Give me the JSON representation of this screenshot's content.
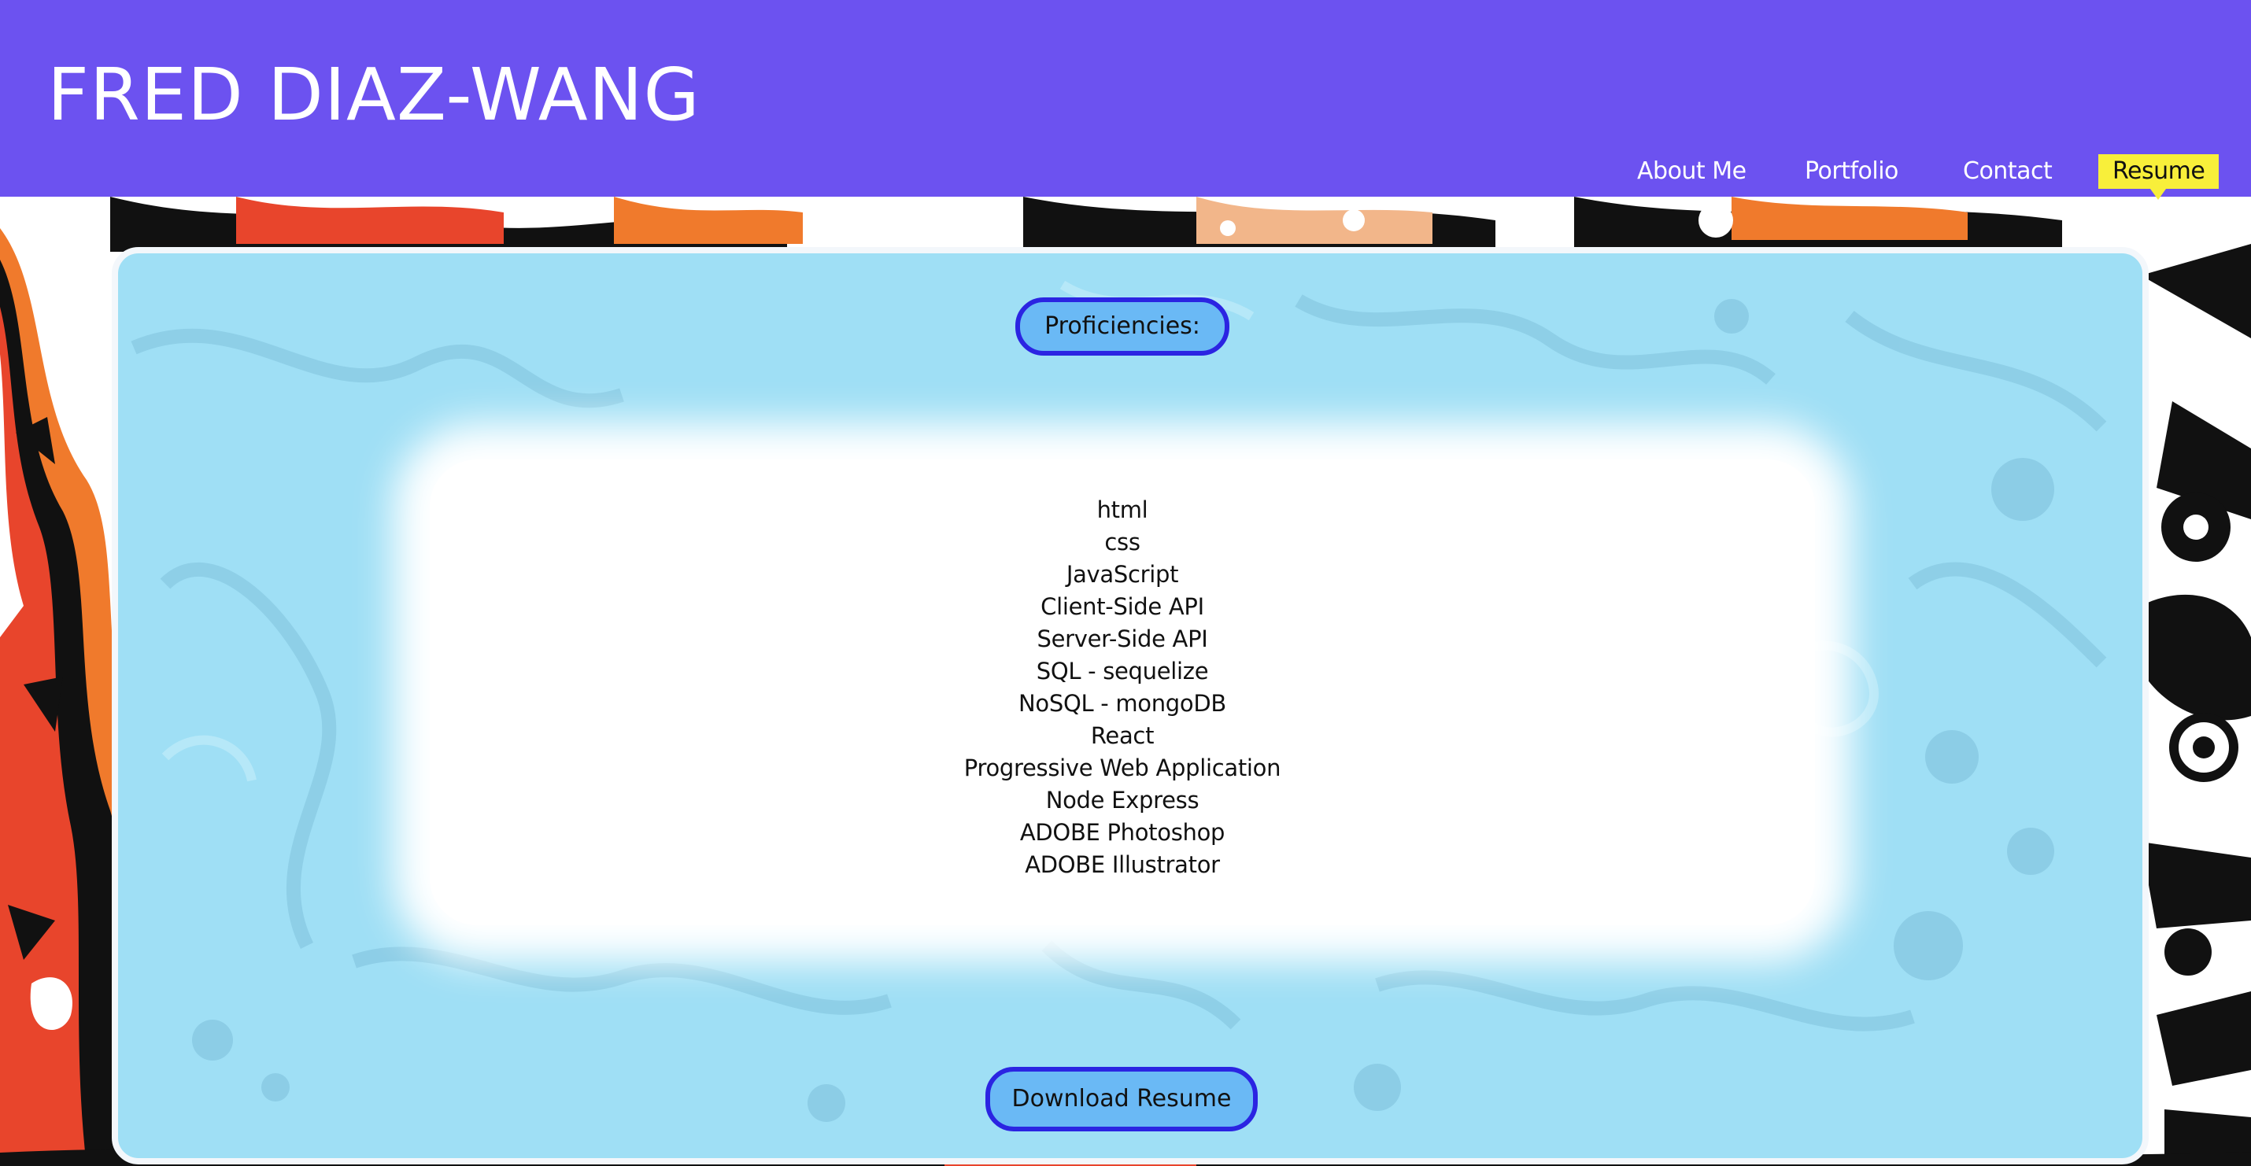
{
  "header": {
    "title": "FRED DIAZ-WANG",
    "background_color": "#6c52f0"
  },
  "nav": {
    "items": [
      {
        "label": "About Me",
        "active": false
      },
      {
        "label": "Portfolio",
        "active": false
      },
      {
        "label": "Contact",
        "active": false
      },
      {
        "label": "Resume",
        "active": true
      }
    ],
    "active_highlight_color": "#f8ef3a"
  },
  "proficiencies": {
    "heading": "Proficiencies:",
    "items": [
      "html",
      "css",
      "JavaScript",
      "Client-Side API",
      "Server-Side API",
      "SQL - sequelize",
      "NoSQL - mongoDB",
      "React",
      "Progressive Web Application",
      "Node Express",
      "ADOBE Photoshop",
      "ADOBE Illustrator"
    ]
  },
  "download": {
    "label": "Download Resume"
  },
  "colors": {
    "card_background": "#9fdff5",
    "pill_fill": "#6ab9f5",
    "pill_border": "#2b24e2"
  }
}
